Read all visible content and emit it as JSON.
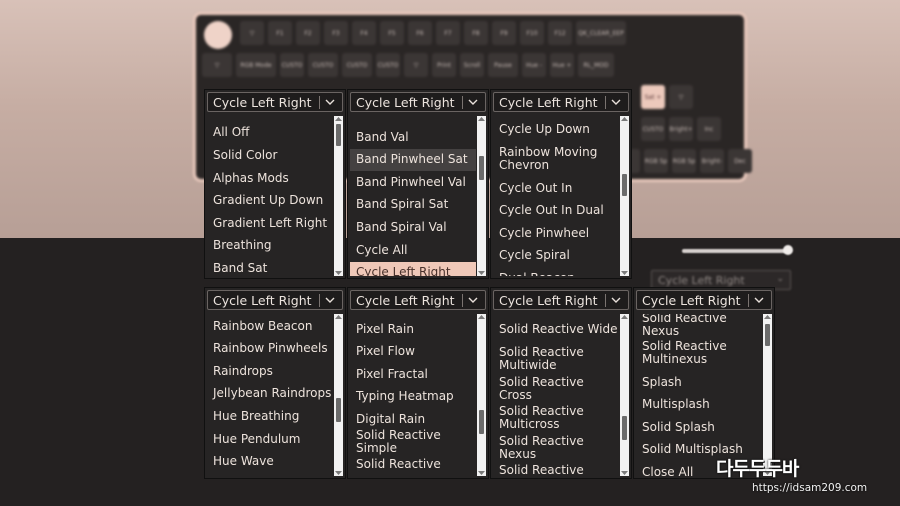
{
  "dropdowns": [
    {
      "selected": "Cycle Left Right",
      "options": [
        {
          "label": "All Off"
        },
        {
          "label": "Solid Color"
        },
        {
          "label": "Alphas Mods"
        },
        {
          "label": "Gradient Up Down"
        },
        {
          "label": "Gradient Left Right"
        },
        {
          "label": "Breathing"
        },
        {
          "label": "Band Sat"
        }
      ]
    },
    {
      "selected": "Cycle Left Right",
      "options": [
        {
          "label": "Band Val"
        },
        {
          "label": "Band Pinwheel Sat",
          "state": "hover"
        },
        {
          "label": "Band Pinwheel Val"
        },
        {
          "label": "Band Spiral Sat"
        },
        {
          "label": "Band Spiral Val"
        },
        {
          "label": "Cycle All"
        },
        {
          "label": "Cycle Left Right",
          "state": "selected"
        }
      ]
    },
    {
      "selected": "Cycle Left Right",
      "options": [
        {
          "label": "Cycle Up Down"
        },
        {
          "label": "Rainbow Moving Chevron"
        },
        {
          "label": "Cycle Out In"
        },
        {
          "label": "Cycle Out In Dual"
        },
        {
          "label": "Cycle Pinwheel"
        },
        {
          "label": "Cycle Spiral"
        },
        {
          "label": "Dual Beacon"
        }
      ]
    },
    {
      "selected": "Cycle Left Right",
      "options": [
        {
          "label": "Rainbow Beacon"
        },
        {
          "label": "Rainbow Pinwheels"
        },
        {
          "label": "Raindrops"
        },
        {
          "label": "Jellybean Raindrops"
        },
        {
          "label": "Hue Breathing"
        },
        {
          "label": "Hue Pendulum"
        },
        {
          "label": "Hue Wave"
        }
      ]
    },
    {
      "selected": "Cycle Left Right",
      "options": [
        {
          "label": "Pixel Rain"
        },
        {
          "label": "Pixel Flow"
        },
        {
          "label": "Pixel Fractal"
        },
        {
          "label": "Typing Heatmap"
        },
        {
          "label": "Digital Rain"
        },
        {
          "label": "Solid Reactive Simple"
        },
        {
          "label": "Solid Reactive"
        }
      ]
    },
    {
      "selected": "Cycle Left Right",
      "options": [
        {
          "label": "Solid Reactive Wide"
        },
        {
          "label": "Solid Reactive Multiwide"
        },
        {
          "label": "Solid Reactive Cross"
        },
        {
          "label": "Solid Reactive Multicross"
        },
        {
          "label": "Solid Reactive Nexus"
        },
        {
          "label": "Solid Reactive Multinexus"
        }
      ]
    },
    {
      "selected": "Cycle Left Right",
      "options": [
        {
          "label": "Solid Reactive Nexus"
        },
        {
          "label": "Solid Reactive Multinexus"
        },
        {
          "label": "Splash"
        },
        {
          "label": "Multisplash"
        },
        {
          "label": "Solid Splash"
        },
        {
          "label": "Solid Multisplash"
        },
        {
          "label": "Close All"
        }
      ]
    }
  ],
  "background": {
    "select_value": "Cycle Left Right",
    "keys_row1": [
      "F1",
      "F2",
      "F3",
      "F4",
      "F5",
      "F6",
      "F7",
      "F8",
      "F9",
      "F10",
      "F12",
      "QK_CLEAR_EEP"
    ],
    "keys_row2": [
      "RGB Mode",
      "CUSTO",
      "CUSTO",
      "CUSTO",
      "CUSTO",
      "Print",
      "Scroll",
      "Pause",
      "Hue -",
      "Hue +",
      "RL_MOD"
    ],
    "keys_side": [
      "Sat +",
      "CUSTO",
      "Bright+",
      "Inc",
      "RGB Sp",
      "RGB Sp",
      "Bright-",
      "Dec"
    ]
  },
  "watermark": {
    "logo": "다두두두바",
    "url": "https://idsam209.com"
  },
  "colors": {
    "accent": "#efc8b8",
    "panel_bg": "#262424",
    "option_text": "#ede3dc",
    "hover_bg": "#444141"
  }
}
